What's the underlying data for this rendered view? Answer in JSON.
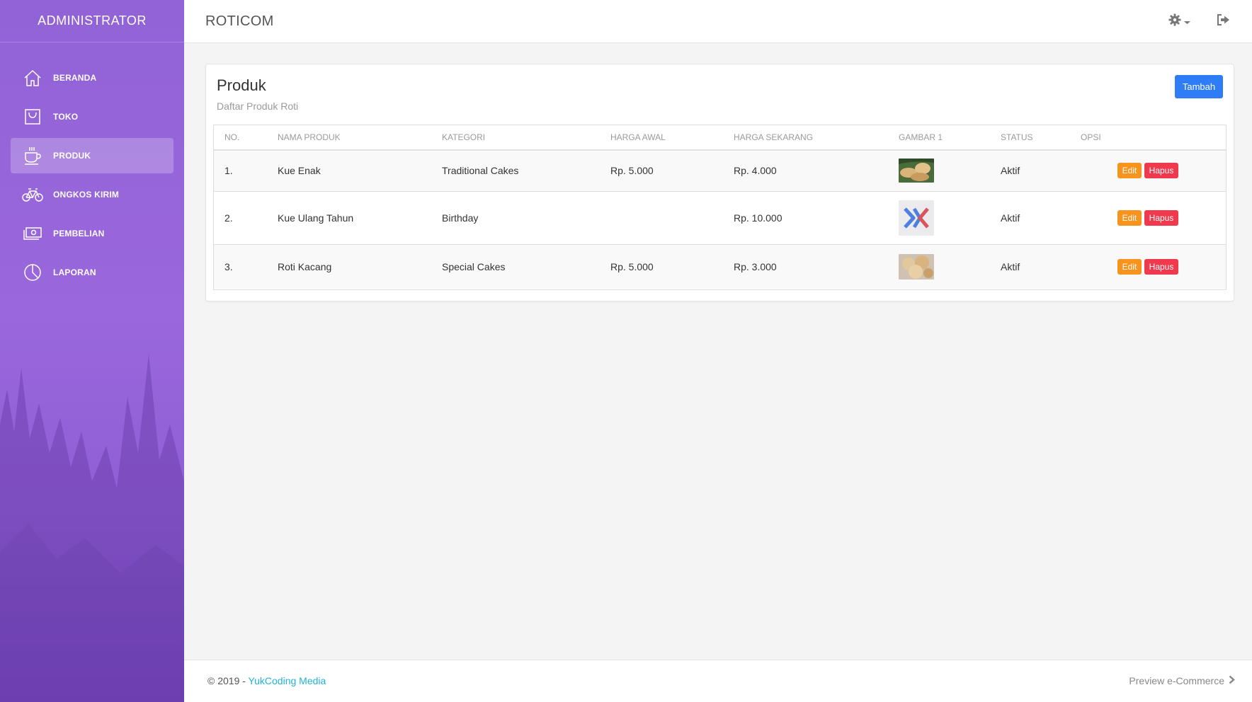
{
  "sidebar": {
    "brand": "ADMINISTRATOR",
    "items": [
      {
        "label": "BERANDA",
        "icon": "home-icon"
      },
      {
        "label": "TOKO",
        "icon": "shopping-bag-icon"
      },
      {
        "label": "PRODUK",
        "icon": "coffee-cup-icon",
        "active": true
      },
      {
        "label": "ONGKOS KIRIM",
        "icon": "bicycle-icon"
      },
      {
        "label": "PEMBELIAN",
        "icon": "money-icon"
      },
      {
        "label": "LAPORAN",
        "icon": "pie-chart-icon"
      }
    ]
  },
  "topbar": {
    "brand": "ROTICOM",
    "settings_icon": "gear-icon",
    "logout_icon": "sign-out-icon"
  },
  "card": {
    "title": "Produk",
    "subtitle": "Daftar Produk Roti",
    "add_label": "Tambah"
  },
  "table": {
    "headers": [
      "NO.",
      "NAMA PRODUK",
      "KATEGORI",
      "HARGA AWAL",
      "HARGA SEKARANG",
      "GAMBAR 1",
      "STATUS",
      "OPSI"
    ],
    "rows": [
      {
        "no": "1.",
        "name": "Kue Enak",
        "category": "Traditional Cakes",
        "price_initial": "Rp. 5.000",
        "price_current": "Rp. 4.000",
        "status": "Aktif",
        "edit": "Edit",
        "delete": "Hapus"
      },
      {
        "no": "2.",
        "name": "Kue Ulang Tahun",
        "category": "Birthday",
        "price_initial": "",
        "price_current": "Rp. 10.000",
        "status": "Aktif",
        "edit": "Edit",
        "delete": "Hapus"
      },
      {
        "no": "3.",
        "name": "Roti Kacang",
        "category": "Special Cakes",
        "price_initial": "Rp. 5.000",
        "price_current": "Rp. 3.000",
        "status": "Aktif",
        "edit": "Edit",
        "delete": "Hapus"
      }
    ]
  },
  "footer": {
    "copyright": "© 2019 - ",
    "link": "YukCoding Media",
    "preview": "Preview e-Commerce"
  },
  "colors": {
    "sidebar": "#9163d6",
    "primary": "#2e7cf6",
    "edit": "#f7941d",
    "delete": "#f0394d",
    "link": "#1fb4d6"
  }
}
